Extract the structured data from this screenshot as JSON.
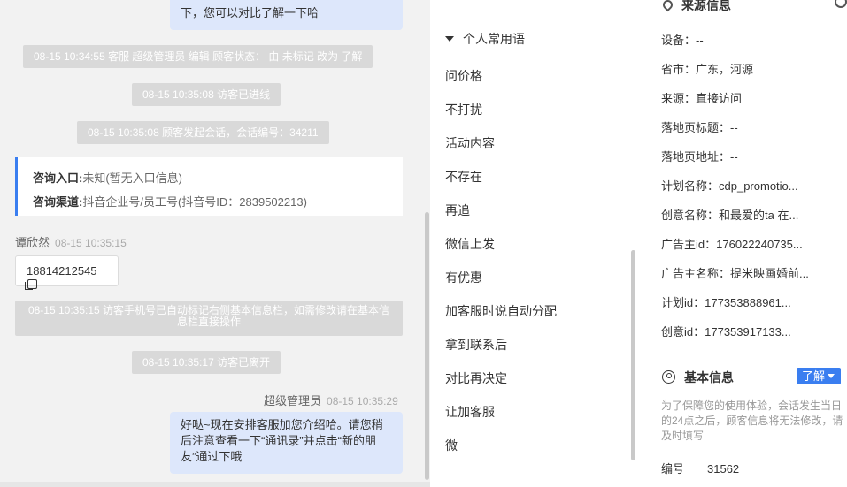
{
  "chat": {
    "top_bubble": "下，您可以对比了解一下哈",
    "sys1": "08-15 10:34:55 客服 超级管理员 编辑 顾客状态： 由 未标记 改为 了解",
    "sys2": "08-15 10:35:08 访客已进线",
    "sys3": "08-15 10:35:08 顾客发起会话，会话编号：34211",
    "card": {
      "entry_label": "咨询入口:",
      "entry_value": "未知(暂无入口信息)",
      "channel_label": "咨询渠道:",
      "channel_value": "抖音企业号/员工号(抖音号ID：2839502213)"
    },
    "visitor_name": "谭欣然",
    "visitor_time": "08-15 10:35:15",
    "phone": "18814212545",
    "sys4": "08-15 10:35:15 访客手机号已自动标记右侧基本信息栏，如需修改请在基本信息栏直接操作",
    "sys5": "08-15 10:35:17 访客已离开",
    "agent_name": "超级管理员",
    "agent_time": "08-15 10:35:29",
    "agent_msg": "好哒~现在安排客服加您介绍哈。请您稍后注意查看一下“通讯录”并点击“新的朋友”通过下哦"
  },
  "phrases": {
    "header": "个人常用语",
    "items": [
      "问价格",
      "不打扰",
      "活动内容",
      "不存在",
      "再追",
      "微信上发",
      "有优惠",
      "加客服时说自动分配",
      "拿到联系后",
      "对比再决定",
      "让加客服",
      "微"
    ]
  },
  "info": {
    "source_title": "来源信息",
    "fields": [
      {
        "label": "设备：",
        "value": "--"
      },
      {
        "label": "省市：",
        "value": "广东，河源"
      },
      {
        "label": "来源：",
        "value": "直接访问"
      },
      {
        "label": "落地页标题：",
        "value": "--"
      },
      {
        "label": "落地页地址：",
        "value": "--"
      },
      {
        "label": "计划名称：",
        "value": "cdp_promotio..."
      },
      {
        "label": "创意名称：",
        "value": "和最爱的ta 在..."
      },
      {
        "label": "广告主id：",
        "value": "176022240735..."
      },
      {
        "label": "广告主名称：",
        "value": "提米映画婚前..."
      },
      {
        "label": "计划id：",
        "value": "177353888961..."
      },
      {
        "label": "创意id：",
        "value": "177353917133..."
      }
    ],
    "basic_title": "基本信息",
    "understand_btn": "了解",
    "notice": "为了保障您的使用体验，会话发生当日的24点之后，顾客信息将无法修改，请及时填写",
    "number_label": "编号",
    "number_value": "31562"
  }
}
